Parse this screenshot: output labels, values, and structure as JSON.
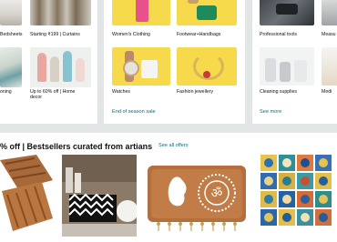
{
  "cards": {
    "left": {
      "items": [
        {
          "label": "Bedsheets"
        },
        {
          "label": "Starting ₹199 | Curtains"
        },
        {
          "label": "oning"
        },
        {
          "label": "Up to 60% off | Home decor"
        }
      ]
    },
    "middle": {
      "items": [
        {
          "label": "Women's Clothing"
        },
        {
          "label": "Footwear+Handbags"
        },
        {
          "label": "Watches"
        },
        {
          "label": "Fashion jewellery"
        }
      ],
      "link": "End of season sale"
    },
    "right": {
      "items": [
        {
          "label": "Professional tools"
        },
        {
          "label": "Measu"
        },
        {
          "label": "Cleaning supplies"
        },
        {
          "label": "Medi"
        }
      ],
      "link": "See more"
    }
  },
  "bestsellers": {
    "title": "% off | Bestsellers curated from artians",
    "see_all": "See all offers",
    "products": [
      {
        "name": "wooden-tray-product"
      },
      {
        "name": "desk-organizer-product"
      },
      {
        "name": "ganesha-key-holder-product"
      },
      {
        "name": "ceramic-tiles-product"
      }
    ]
  },
  "colors": {
    "background": "#e3e6e6",
    "card": "#ffffff",
    "link": "#007185",
    "yellow_tile": "#f7d94c"
  }
}
